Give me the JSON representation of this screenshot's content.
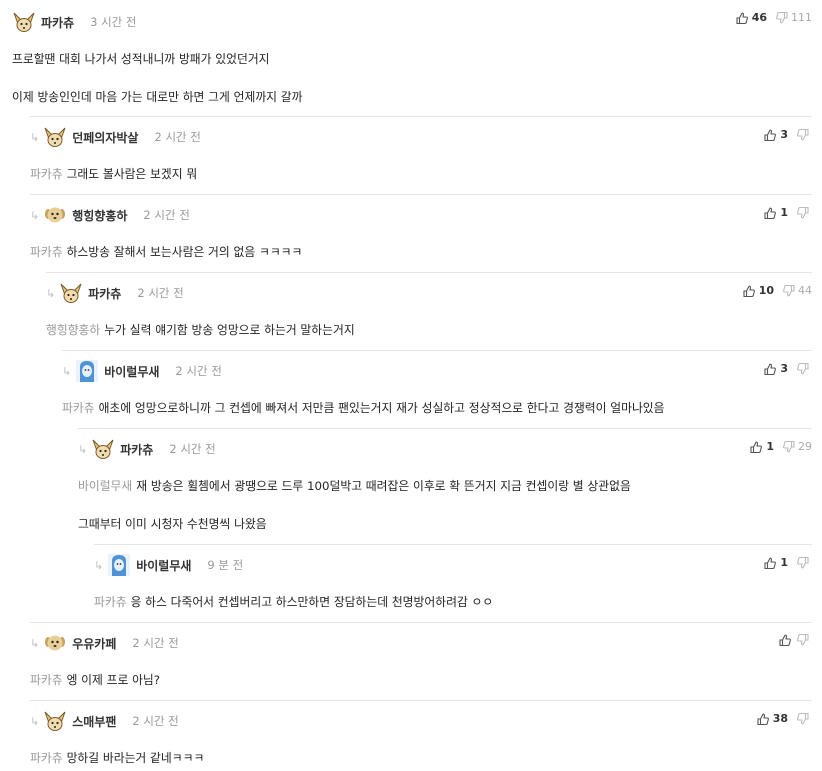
{
  "comments": [
    {
      "nickname": "파카츄",
      "time": "3 시간 전",
      "avatar": "fennec-fox-avatar",
      "upvotes": "46",
      "downvotes": "111",
      "mention": "",
      "lines": [
        "프로할땐 대회 나가서 성적내니까 방패가 있었던거지",
        "이제 방송인인데 마음 가는 대로만 하면 그게 언제까지 갈까"
      ]
    },
    {
      "nickname": "던페의자박살",
      "time": "2 시간 전",
      "avatar": "fennec-fox-avatar",
      "upvotes": "3",
      "downvotes": "",
      "mention": "파카츄",
      "lines": [
        "그래도 볼사람은 보겠지 뭐"
      ]
    },
    {
      "nickname": "행힝향홍하",
      "time": "2 시간 전",
      "avatar": "puppy-avatar",
      "upvotes": "1",
      "downvotes": "",
      "mention": "파카츄",
      "lines": [
        "하스방송 잘해서 보는사람은 거의 없음 ㅋㅋㅋㅋ"
      ]
    },
    {
      "nickname": "파카츄",
      "time": "2 시간 전",
      "avatar": "fennec-fox-avatar",
      "upvotes": "10",
      "downvotes": "44",
      "mention": "행힝향홍하",
      "lines": [
        "누가 실력 얘기함 방송 엉망으로 하는거 말하는거지"
      ]
    },
    {
      "nickname": "바이럴무새",
      "time": "2 시간 전",
      "avatar": "blue-character-avatar",
      "upvotes": "3",
      "downvotes": "",
      "mention": "파카츄",
      "lines": [
        "애초에 엉망으로하니까 그 컨셉에 빠져서 저만큼 팬있는거지 재가 성실하고 정상적으로 한다고 경쟁력이 얼마나있음"
      ]
    },
    {
      "nickname": "파카츄",
      "time": "2 시간 전",
      "avatar": "fennec-fox-avatar",
      "upvotes": "1",
      "downvotes": "29",
      "mention": "바이럴무새",
      "lines": [
        "재 방송은 휠쳄에서 광땡으로 드루 100덜박고 때려잡은 이후로 확 뜬거지 지금 컨셉이랑 별 상관없음",
        "그때부터 이미 시청자 수천명씩 나왔음"
      ]
    },
    {
      "nickname": "바이럴무새",
      "time": "9 분 전",
      "avatar": "blue-character-avatar",
      "upvotes": "1",
      "downvotes": "",
      "mention": "파카츄",
      "lines": [
        "응 하스 다죽어서 컨셉버리고 하스만하면 장담하는데 천명방어하려감 ㅇㅇ"
      ]
    },
    {
      "nickname": "우유카페",
      "time": "2 시간 전",
      "avatar": "puppy-avatar",
      "upvotes": "",
      "downvotes": "",
      "mention": "파카츄",
      "lines": [
        "엥 이제 프로 아님?"
      ]
    },
    {
      "nickname": "스매부팬",
      "time": "2 시간 전",
      "avatar": "fennec-fox-avatar",
      "upvotes": "38",
      "downvotes": "",
      "mention": "파카츄",
      "lines": [
        "망하길 바라는거 같네ㅋㅋㅋ"
      ]
    }
  ],
  "icons": {
    "reply": "reply-arrow-icon",
    "upvote": "thumbs-up-icon",
    "downvote": "thumbs-down-icon"
  },
  "colors": {
    "nickname": "#333333",
    "meta": "#999999",
    "divider": "#e6e6e6",
    "vote_icon": "#555555",
    "down_icon": "#bbbbbb"
  }
}
